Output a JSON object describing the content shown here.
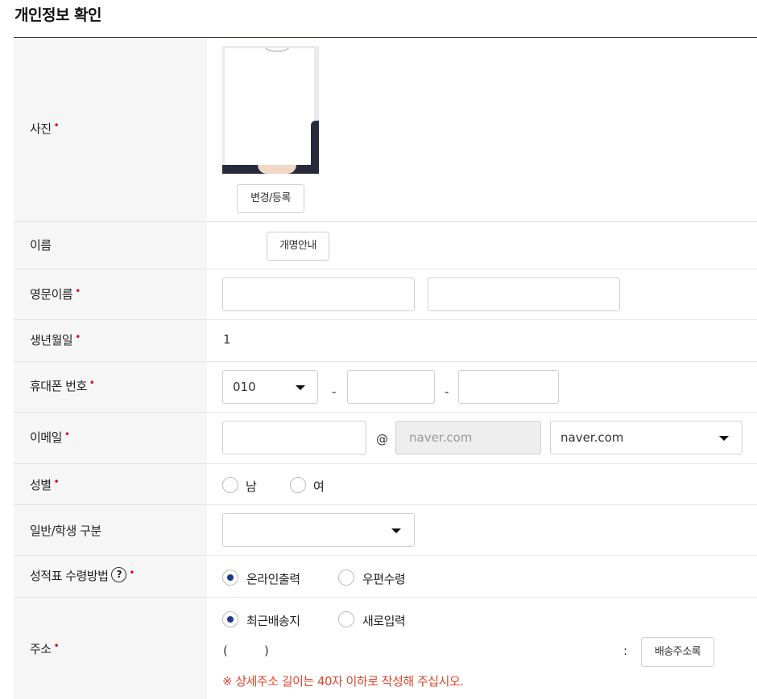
{
  "page": {
    "title": "개인정보 확인"
  },
  "labels": {
    "photo": "사진",
    "name": "이름",
    "english_name": "영문이름",
    "birthdate": "생년월일",
    "phone": "휴대폰 번호",
    "email": "이메일",
    "gender": "성별",
    "category": "일반/학생 구분",
    "report_method": "성적표 수령방법",
    "address": "주소",
    "required_mark": "•"
  },
  "photo": {
    "change_button": "변경/등록"
  },
  "name": {
    "rename_button": "개명안내"
  },
  "english_name": {
    "first_value": "",
    "last_value": ""
  },
  "birthdate": {
    "value": "1"
  },
  "phone": {
    "prefix": "010",
    "middle": "",
    "last": "",
    "separator": "-"
  },
  "email": {
    "local_value": "",
    "at": "@",
    "domain_value": "naver.com",
    "domain_select": "naver.com"
  },
  "gender": {
    "options": [
      "남",
      "여"
    ],
    "selected": null
  },
  "category": {
    "selected": ""
  },
  "report_method": {
    "help": "?",
    "options": [
      "온라인출력",
      "우편수령"
    ],
    "selected": 0
  },
  "address": {
    "options": [
      "최근배송지",
      "새로입력"
    ],
    "selected": 0,
    "zip_open": "(",
    "zip_close": ")",
    "colon": ":",
    "book_button": "배송주소록",
    "notice": "※ 상세주소 길이는 40자 이하로 작성해 주십시오."
  },
  "colors": {
    "required": "#e60012",
    "radio_on": "#1d3a8f",
    "notice": "#e3442b"
  },
  "icons": {
    "select": "chevron-down-icon",
    "help": "question-circle-icon"
  }
}
